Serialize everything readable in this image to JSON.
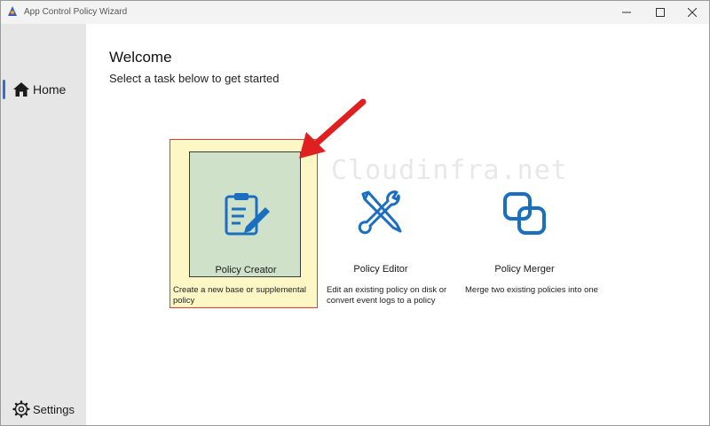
{
  "window": {
    "title": "App Control Policy Wizard"
  },
  "sidebar": {
    "home_label": "Home",
    "settings_label": "Settings"
  },
  "main": {
    "heading": "Welcome",
    "subtitle": "Select a task below to get started",
    "watermark": "Cloudinfra.net",
    "cards": [
      {
        "title": "Policy Creator",
        "description": "Create a new base or supplemental policy",
        "icon": "clipboard-pencil-icon",
        "selected": true
      },
      {
        "title": "Policy Editor",
        "description": "Edit an existing policy on disk or convert event logs to a policy",
        "icon": "tools-icon",
        "selected": false
      },
      {
        "title": "Policy Merger",
        "description": "Merge two existing policies into one",
        "icon": "merge-squares-icon",
        "selected": false
      }
    ]
  },
  "colors": {
    "accent": "#2f6fd6",
    "icon_blue": "#1a6fc0",
    "selected_card_bg": "#cfe2c9",
    "highlight_bg": "#fdf6c5",
    "annotation_red": "#e02020"
  }
}
